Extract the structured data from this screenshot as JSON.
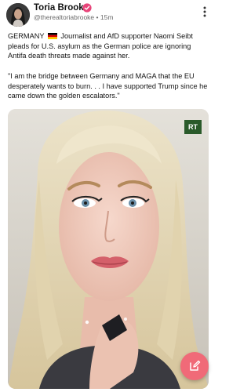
{
  "post": {
    "author_name": "Toria Brooke",
    "author_handle": "@therealtoriabrooke",
    "separator": " • ",
    "time_ago": "15m",
    "paragraph1_lead": "GERMANY",
    "paragraph1_rest": "Journalist and AfD supporter Naomi Seibt pleads for U.S. asylum as the German police are ignoring Antifa death threats made against her.",
    "paragraph2": "\"I am the bridge between Germany and MAGA that the EU desperately wants to burn. . . I have supported Trump since he came down the golden escalators.\""
  },
  "media": {
    "watermark": "RT"
  },
  "icons": {
    "verified": "verified-badge-icon",
    "more": "more-vertical-icon",
    "compose": "pencil-edit-icon",
    "flag": "germany-flag-icon"
  },
  "colors": {
    "verified": "#e8457a",
    "fab": "#f06a78",
    "rt_logo": "#2a5a2a"
  }
}
